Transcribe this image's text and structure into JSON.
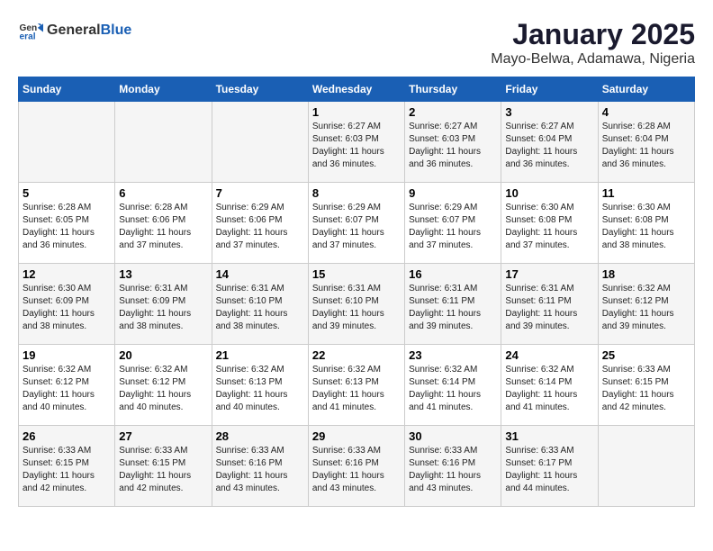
{
  "header": {
    "logo_general": "General",
    "logo_blue": "Blue",
    "title": "January 2025",
    "subtitle": "Mayo-Belwa, Adamawa, Nigeria"
  },
  "days_of_week": [
    "Sunday",
    "Monday",
    "Tuesday",
    "Wednesday",
    "Thursday",
    "Friday",
    "Saturday"
  ],
  "weeks": [
    [
      {
        "day": "",
        "sunrise": "",
        "sunset": "",
        "daylight": ""
      },
      {
        "day": "",
        "sunrise": "",
        "sunset": "",
        "daylight": ""
      },
      {
        "day": "",
        "sunrise": "",
        "sunset": "",
        "daylight": ""
      },
      {
        "day": "1",
        "sunrise": "6:27 AM",
        "sunset": "6:03 PM",
        "daylight": "11 hours and 36 minutes."
      },
      {
        "day": "2",
        "sunrise": "6:27 AM",
        "sunset": "6:03 PM",
        "daylight": "11 hours and 36 minutes."
      },
      {
        "day": "3",
        "sunrise": "6:27 AM",
        "sunset": "6:04 PM",
        "daylight": "11 hours and 36 minutes."
      },
      {
        "day": "4",
        "sunrise": "6:28 AM",
        "sunset": "6:04 PM",
        "daylight": "11 hours and 36 minutes."
      }
    ],
    [
      {
        "day": "5",
        "sunrise": "6:28 AM",
        "sunset": "6:05 PM",
        "daylight": "11 hours and 36 minutes."
      },
      {
        "day": "6",
        "sunrise": "6:28 AM",
        "sunset": "6:06 PM",
        "daylight": "11 hours and 37 minutes."
      },
      {
        "day": "7",
        "sunrise": "6:29 AM",
        "sunset": "6:06 PM",
        "daylight": "11 hours and 37 minutes."
      },
      {
        "day": "8",
        "sunrise": "6:29 AM",
        "sunset": "6:07 PM",
        "daylight": "11 hours and 37 minutes."
      },
      {
        "day": "9",
        "sunrise": "6:29 AM",
        "sunset": "6:07 PM",
        "daylight": "11 hours and 37 minutes."
      },
      {
        "day": "10",
        "sunrise": "6:30 AM",
        "sunset": "6:08 PM",
        "daylight": "11 hours and 37 minutes."
      },
      {
        "day": "11",
        "sunrise": "6:30 AM",
        "sunset": "6:08 PM",
        "daylight": "11 hours and 38 minutes."
      }
    ],
    [
      {
        "day": "12",
        "sunrise": "6:30 AM",
        "sunset": "6:09 PM",
        "daylight": "11 hours and 38 minutes."
      },
      {
        "day": "13",
        "sunrise": "6:31 AM",
        "sunset": "6:09 PM",
        "daylight": "11 hours and 38 minutes."
      },
      {
        "day": "14",
        "sunrise": "6:31 AM",
        "sunset": "6:10 PM",
        "daylight": "11 hours and 38 minutes."
      },
      {
        "day": "15",
        "sunrise": "6:31 AM",
        "sunset": "6:10 PM",
        "daylight": "11 hours and 39 minutes."
      },
      {
        "day": "16",
        "sunrise": "6:31 AM",
        "sunset": "6:11 PM",
        "daylight": "11 hours and 39 minutes."
      },
      {
        "day": "17",
        "sunrise": "6:31 AM",
        "sunset": "6:11 PM",
        "daylight": "11 hours and 39 minutes."
      },
      {
        "day": "18",
        "sunrise": "6:32 AM",
        "sunset": "6:12 PM",
        "daylight": "11 hours and 39 minutes."
      }
    ],
    [
      {
        "day": "19",
        "sunrise": "6:32 AM",
        "sunset": "6:12 PM",
        "daylight": "11 hours and 40 minutes."
      },
      {
        "day": "20",
        "sunrise": "6:32 AM",
        "sunset": "6:12 PM",
        "daylight": "11 hours and 40 minutes."
      },
      {
        "day": "21",
        "sunrise": "6:32 AM",
        "sunset": "6:13 PM",
        "daylight": "11 hours and 40 minutes."
      },
      {
        "day": "22",
        "sunrise": "6:32 AM",
        "sunset": "6:13 PM",
        "daylight": "11 hours and 41 minutes."
      },
      {
        "day": "23",
        "sunrise": "6:32 AM",
        "sunset": "6:14 PM",
        "daylight": "11 hours and 41 minutes."
      },
      {
        "day": "24",
        "sunrise": "6:32 AM",
        "sunset": "6:14 PM",
        "daylight": "11 hours and 41 minutes."
      },
      {
        "day": "25",
        "sunrise": "6:33 AM",
        "sunset": "6:15 PM",
        "daylight": "11 hours and 42 minutes."
      }
    ],
    [
      {
        "day": "26",
        "sunrise": "6:33 AM",
        "sunset": "6:15 PM",
        "daylight": "11 hours and 42 minutes."
      },
      {
        "day": "27",
        "sunrise": "6:33 AM",
        "sunset": "6:15 PM",
        "daylight": "11 hours and 42 minutes."
      },
      {
        "day": "28",
        "sunrise": "6:33 AM",
        "sunset": "6:16 PM",
        "daylight": "11 hours and 43 minutes."
      },
      {
        "day": "29",
        "sunrise": "6:33 AM",
        "sunset": "6:16 PM",
        "daylight": "11 hours and 43 minutes."
      },
      {
        "day": "30",
        "sunrise": "6:33 AM",
        "sunset": "6:16 PM",
        "daylight": "11 hours and 43 minutes."
      },
      {
        "day": "31",
        "sunrise": "6:33 AM",
        "sunset": "6:17 PM",
        "daylight": "11 hours and 44 minutes."
      },
      {
        "day": "",
        "sunrise": "",
        "sunset": "",
        "daylight": ""
      }
    ]
  ]
}
